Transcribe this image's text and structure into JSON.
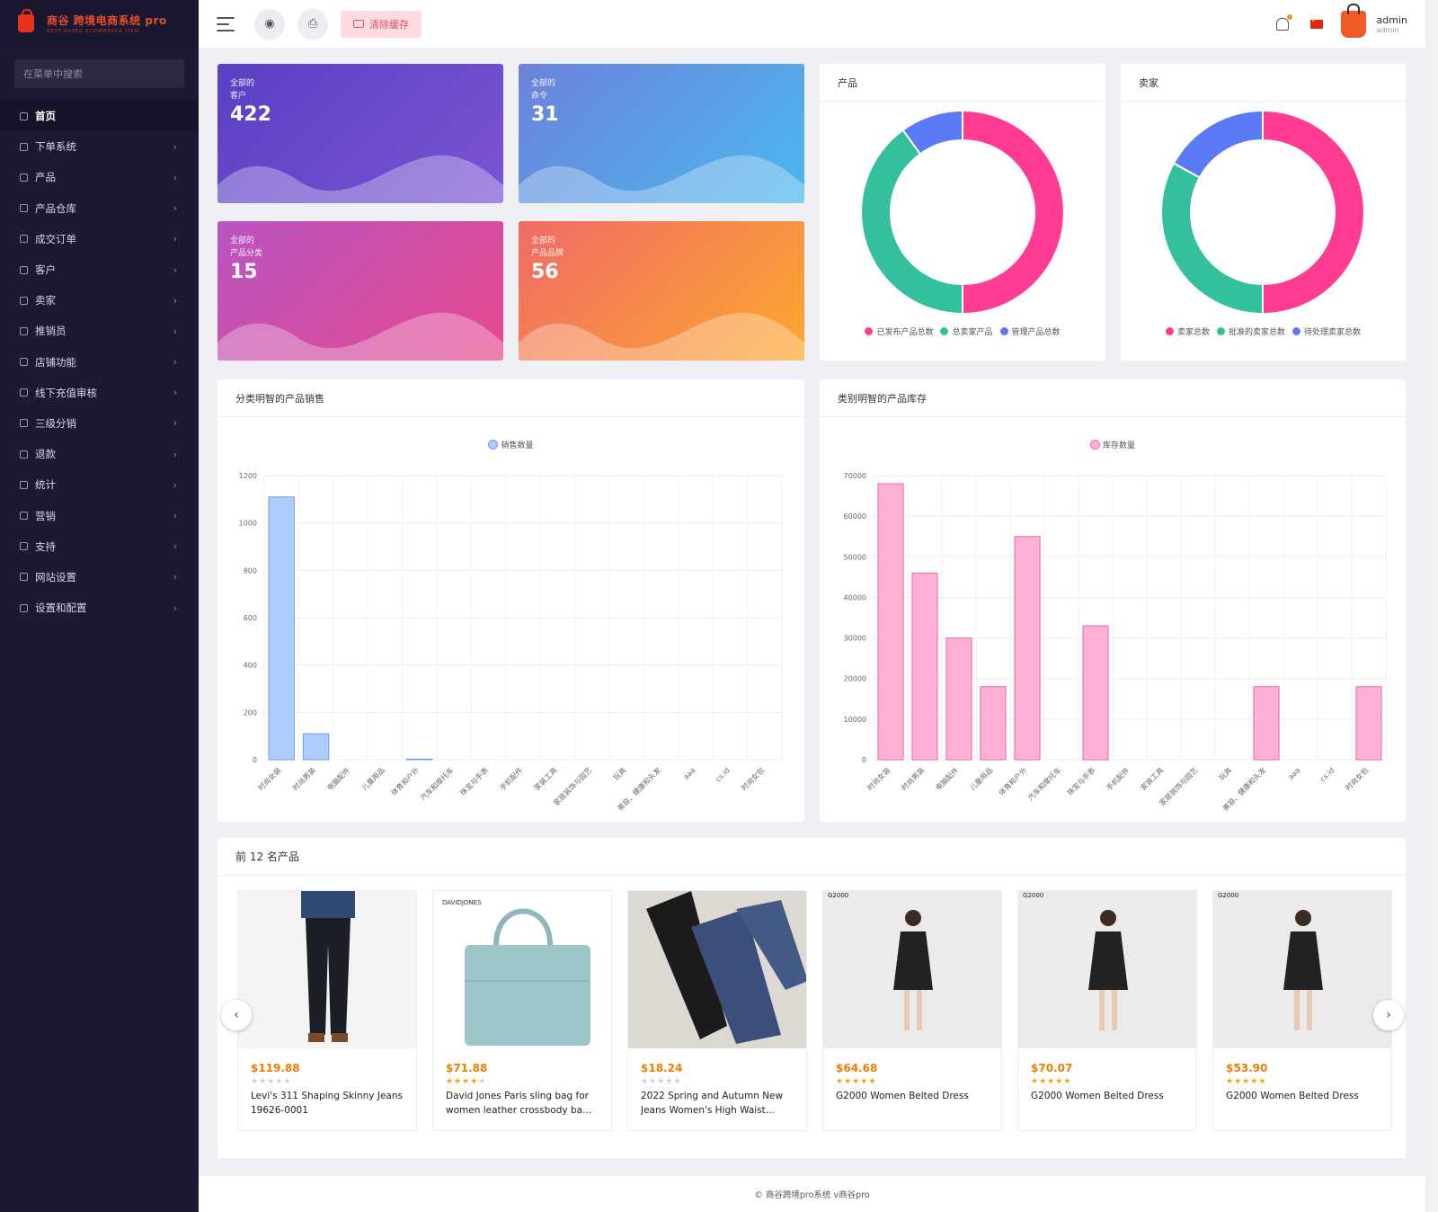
{
  "brand": {
    "name": "商谷  跨境电商系统  pro",
    "tagline": "BEST RATED ECOMMERCE ITEM"
  },
  "sidebar": {
    "search_placeholder": "在菜单中搜索",
    "items": [
      {
        "label": "首页",
        "icon": "home-icon",
        "active": true
      },
      {
        "label": "下单系统",
        "icon": "list-icon"
      },
      {
        "label": "产品",
        "icon": "cart-icon"
      },
      {
        "label": "产品仓库",
        "icon": "warehouse-icon"
      },
      {
        "label": "成交订单",
        "icon": "order-icon"
      },
      {
        "label": "客户",
        "icon": "users-icon"
      },
      {
        "label": "卖家",
        "icon": "user-icon"
      },
      {
        "label": "推销员",
        "icon": "user-icon"
      },
      {
        "label": "店铺功能",
        "icon": "user-icon"
      },
      {
        "label": "线下充值审核",
        "icon": "money-icon"
      },
      {
        "label": "三级分销",
        "icon": "link-icon"
      },
      {
        "label": "退款",
        "icon": "refund-icon"
      },
      {
        "label": "统计",
        "icon": "file-icon"
      },
      {
        "label": "营销",
        "icon": "megaphone-icon"
      },
      {
        "label": "支持",
        "icon": "link-icon"
      },
      {
        "label": "网站设置",
        "icon": "monitor-icon"
      },
      {
        "label": "设置和配置",
        "icon": "settings-icon"
      }
    ]
  },
  "header": {
    "clear_cache_label": "清除缓存",
    "user_name": "admin",
    "user_role": "admin"
  },
  "stats": [
    {
      "line1": "全部的",
      "line2": "客户",
      "value": "422"
    },
    {
      "line1": "全部的",
      "line2": "命令",
      "value": "31"
    },
    {
      "line1": "全部的",
      "line2": "产品分类",
      "value": "15"
    },
    {
      "line1": "全部的",
      "line2": "产品品牌",
      "value": "56"
    }
  ],
  "colors": {
    "pink": "#ff3b92",
    "teal": "#34bf9e",
    "blue": "#5b7bf6",
    "sales_bar": "#aecdfc",
    "stock_bar": "#ffb0d6"
  },
  "chart_data": [
    {
      "type": "pie",
      "title": "产品",
      "labels": [
        "已发布产品总数",
        "总卖家产品",
        "管理产品总数"
      ],
      "values": [
        50,
        40,
        10
      ]
    },
    {
      "type": "pie",
      "title": "卖家",
      "labels": [
        "卖家总数",
        "批准的卖家总数",
        "待处理卖家总数"
      ],
      "values": [
        50,
        33,
        17
      ]
    },
    {
      "type": "bar",
      "title": "分类明智的产品销售",
      "series": [
        {
          "name": "销售数量",
          "values": [
            1110,
            110,
            0,
            0,
            3,
            0,
            0,
            0,
            0,
            0,
            0,
            0,
            0,
            0,
            0
          ]
        }
      ],
      "categories": [
        "时尚女装",
        "时尚男装",
        "电脑配件",
        "儿童用品",
        "体育和户外",
        "汽车和摩托车",
        "珠宝与手表",
        "手机配件",
        "家装工具",
        "家居装饰与园艺",
        "玩具",
        "美容、健康和头发",
        "aaa",
        "cs.id",
        "时尚女包"
      ],
      "ylim": [
        0,
        1200
      ],
      "yticks": [
        0,
        200,
        400,
        600,
        800,
        1000,
        1200
      ]
    },
    {
      "type": "bar",
      "title": "类别明智的产品库存",
      "series": [
        {
          "name": "库存数量",
          "values": [
            68000,
            46000,
            30000,
            18000,
            55000,
            0,
            33000,
            0,
            0,
            0,
            0,
            18000,
            0,
            0,
            18000
          ]
        }
      ],
      "categories": [
        "时尚女装",
        "时尚男装",
        "电脑配件",
        "儿童用品",
        "体育和户外",
        "汽车和摩托车",
        "珠宝与手表",
        "手机配件",
        "家装工具",
        "家居装饰与园艺",
        "玩具",
        "美容、健康和头发",
        "aaa",
        "cs.id",
        "时尚女包"
      ],
      "ylim": [
        0,
        70000
      ],
      "yticks": [
        0,
        10000,
        20000,
        30000,
        40000,
        50000,
        60000,
        70000
      ]
    }
  ],
  "products": {
    "title": "前 12 名产品",
    "items": [
      {
        "price": "$119.88",
        "stars": 0,
        "name": "Levi's 311 Shaping Skinny Jeans 19626-0001",
        "kind": "jeans"
      },
      {
        "price": "$71.88",
        "stars": 4,
        "name": "David Jones Paris sling bag for women leather crossbody ba...",
        "kind": "bag"
      },
      {
        "price": "$18.24",
        "stars": 0,
        "name": "2022 Spring and Autumn New Jeans Women's High Waist...",
        "kind": "jeans2"
      },
      {
        "price": "$64.68",
        "stars": 5,
        "name": "G2000 Women Belted Dress",
        "kind": "dress"
      },
      {
        "price": "$70.07",
        "stars": 5,
        "name": "G2000 Women Belted Dress",
        "kind": "dress"
      },
      {
        "price": "$53.90",
        "stars": 5,
        "name": "G2000 Women Belted Dress",
        "kind": "dress"
      }
    ]
  },
  "footer": {
    "text": "© 商谷跨境pro系统 v商谷pro"
  }
}
